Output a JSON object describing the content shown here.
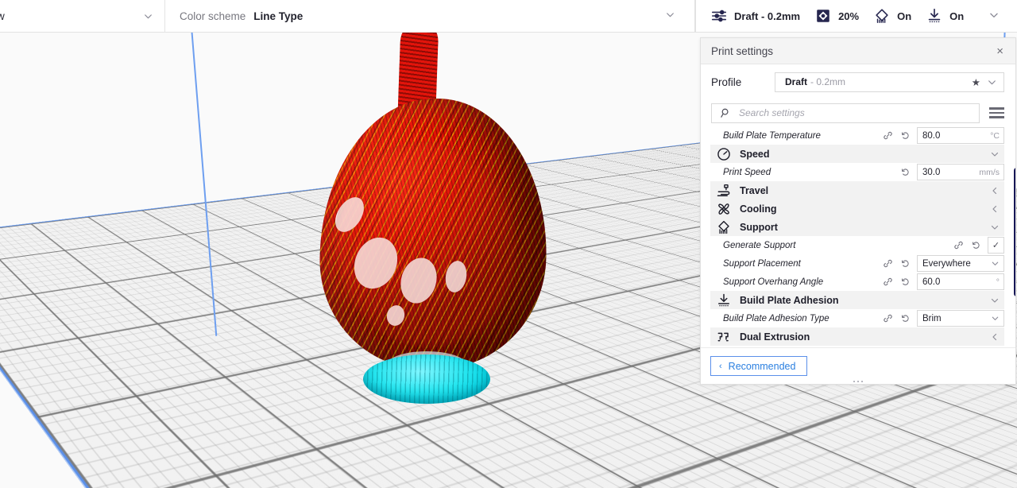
{
  "topbar": {
    "view_select": {
      "value": "w",
      "icon": "chevron-down-icon"
    },
    "color_scheme": {
      "label": "Color scheme",
      "value": "Line Type"
    },
    "quick_settings": [
      {
        "icon": "sliders-icon",
        "label": "Draft - 0.2mm",
        "name": "profile-quick"
      },
      {
        "icon": "infill-icon",
        "label": "20%",
        "name": "infill-quick"
      },
      {
        "icon": "support-icon",
        "label": "On",
        "name": "support-quick"
      },
      {
        "icon": "adhesion-icon",
        "label": "On",
        "name": "adhesion-quick"
      }
    ],
    "expand_icon": "chevron-down-icon"
  },
  "panel": {
    "title": "Print settings",
    "close_label": "×",
    "profile": {
      "label": "Profile",
      "name": "Draft",
      "sub": "- 0.2mm",
      "star": "★",
      "chevron": "⌄"
    },
    "search": {
      "placeholder": "Search settings",
      "value": "",
      "icon": "search-icon",
      "menu_icon": "hamburger-icon"
    },
    "rows": [
      {
        "kind": "setting",
        "label": "Build Plate Temperature",
        "link": true,
        "reset": true,
        "control": "text",
        "value": "80.0",
        "unit": "°C"
      },
      {
        "kind": "category",
        "label": "Speed",
        "icon": "speed-icon",
        "arrow": "⌄",
        "expanded": true
      },
      {
        "kind": "setting",
        "label": "Print Speed",
        "link": false,
        "reset": true,
        "control": "text",
        "value": "30.0",
        "unit": "mm/s"
      },
      {
        "kind": "category",
        "label": "Travel",
        "icon": "travel-icon",
        "arrow": "‹",
        "expanded": false
      },
      {
        "kind": "category",
        "label": "Cooling",
        "icon": "cooling-icon",
        "arrow": "‹",
        "expanded": false
      },
      {
        "kind": "category",
        "label": "Support",
        "icon": "support-icon",
        "arrow": "⌄",
        "expanded": true
      },
      {
        "kind": "setting",
        "label": "Generate Support",
        "link": true,
        "reset": true,
        "control": "checkbox",
        "value": "✓",
        "unit": ""
      },
      {
        "kind": "setting",
        "label": "Support Placement",
        "link": true,
        "reset": true,
        "control": "dropdown",
        "value": "Everywhere",
        "unit": ""
      },
      {
        "kind": "setting",
        "label": "Support Overhang Angle",
        "link": true,
        "reset": true,
        "control": "text",
        "value": "60.0",
        "unit": "°"
      },
      {
        "kind": "category",
        "label": "Build Plate Adhesion",
        "icon": "adhesion-icon",
        "arrow": "⌄",
        "expanded": true
      },
      {
        "kind": "setting",
        "label": "Build Plate Adhesion Type",
        "link": true,
        "reset": true,
        "control": "dropdown",
        "value": "Brim",
        "unit": ""
      },
      {
        "kind": "category",
        "label": "Dual Extrusion",
        "icon": "dual-extrusion-icon",
        "arrow": "‹",
        "expanded": false
      }
    ],
    "footer": {
      "recommended_label": "Recommended",
      "back_chevron": "‹"
    }
  },
  "viewport": {
    "model_name": "sliced-vase-preview",
    "colors": {
      "model_red": "#e81207",
      "infill_yellow": "#ffe400",
      "brim_cyan": "#27e6f0",
      "plate_edge_blue": "#5b90ea",
      "background": "#fafafa",
      "scrollbar": "#161655"
    }
  }
}
